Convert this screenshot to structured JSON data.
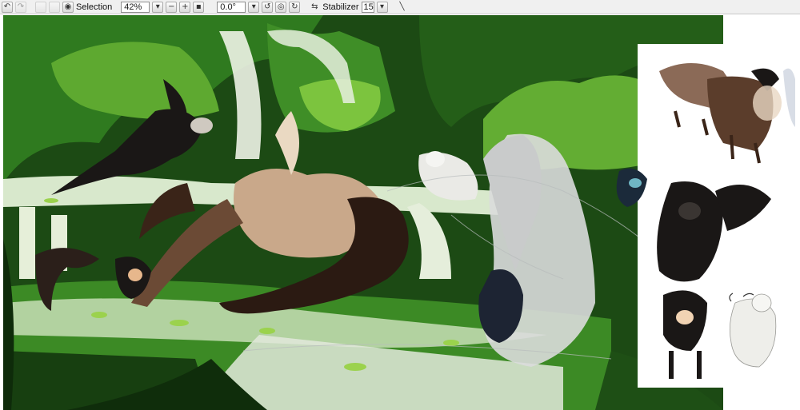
{
  "toolbar": {
    "selection_label": "Selection",
    "zoom_value": "42%",
    "rotation_value": "0.0°",
    "stabilizer_label": "Stabilizer",
    "stabilizer_value": "15"
  },
  "colors": {
    "toolbar_bg": "#f0f0f0",
    "canvas_border": "#ffffff",
    "forest_dark": "#0f2a0c",
    "forest_mid": "#2d6b1f",
    "forest_light": "#6fb43a",
    "moss": "#8dcf4a",
    "water": "#d9e6d0",
    "waterfall": "#eef3e6"
  },
  "icons": [
    "undo-icon",
    "redo-icon",
    "back-icon",
    "forward-icon",
    "eye-icon",
    "dropdown-icon",
    "zoom-out-icon",
    "zoom-in-icon",
    "zoom-reset-icon",
    "rotate-left-icon",
    "rotate-reset-icon",
    "rotate-right-icon",
    "flip-icon",
    "line-icon"
  ]
}
